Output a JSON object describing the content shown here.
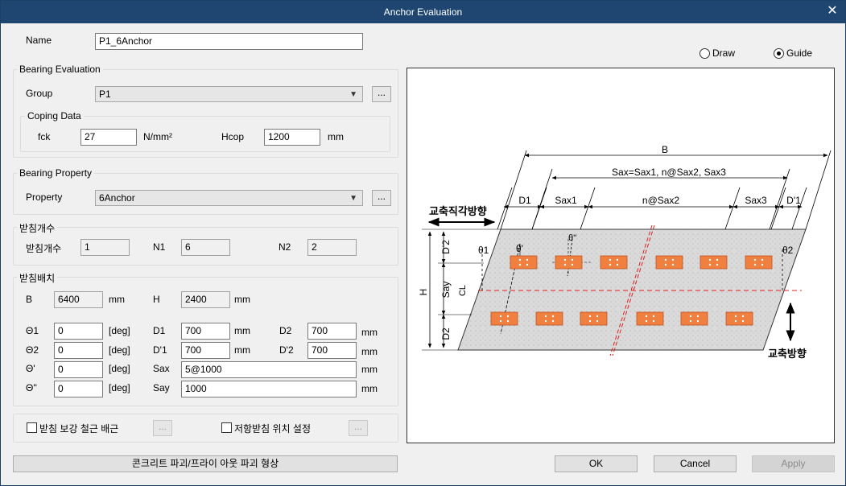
{
  "window": {
    "title": "Anchor Evaluation",
    "close_icon": "close-icon"
  },
  "name": {
    "label": "Name",
    "value": "P1_6Anchor"
  },
  "view_mode": {
    "draw_label": "Draw",
    "guide_label": "Guide",
    "selected": "Guide"
  },
  "bearing_evaluation": {
    "title": "Bearing Evaluation",
    "group_label": "Group",
    "group_value": "P1",
    "more_label": "...",
    "coping": {
      "title": "Coping Data",
      "fck_label": "fck",
      "fck_value": "27",
      "fck_unit": "N/mm²",
      "hcop_label": "Hcop",
      "hcop_value": "1200",
      "hcop_unit": "mm"
    }
  },
  "bearing_property": {
    "title": "Bearing Property",
    "property_label": "Property",
    "property_value": "6Anchor",
    "more_label": "..."
  },
  "count": {
    "title": "받침개수",
    "count_label": "받침개수",
    "count_value": "1",
    "n1_label": "N1",
    "n1_value": "6",
    "n2_label": "N2",
    "n2_value": "2"
  },
  "layout": {
    "title": "받침배치",
    "b_label": "B",
    "b_value": "6400",
    "b_unit": "mm",
    "h_label": "H",
    "h_value": "2400",
    "h_unit": "mm",
    "theta1_label": "Θ1",
    "theta1_value": "0",
    "theta1_unit": "[deg]",
    "d1_label": "D1",
    "d1_value": "700",
    "d1_unit": "mm",
    "d2_label": "D2",
    "d2_value": "700",
    "d2_unit": "mm",
    "theta2_label": "Θ2",
    "theta2_value": "0",
    "theta2_unit": "[deg]",
    "dp1_label": "D'1",
    "dp1_value": "700",
    "dp1_unit": "mm",
    "dp2_label": "D'2",
    "dp2_value": "700",
    "dp2_unit": "mm",
    "thetap_label": "Θ'",
    "thetap_value": "0",
    "thetap_unit": "[deg]",
    "sax_label": "Sax",
    "sax_value": "5@1000",
    "sax_unit": "mm",
    "thetapp_label": "Θ''",
    "thetapp_value": "0",
    "thetapp_unit": "[deg]",
    "say_label": "Say",
    "say_value": "1000",
    "say_unit": "mm"
  },
  "options": {
    "rebar_label": "받침 보강 철근 배근",
    "rebar_more": "...",
    "position_label": "저항받침 위치 설정",
    "position_more": "..."
  },
  "buttons": {
    "concrete": "콘크리트 파괴/프라이 아웃 파괴 형상",
    "ok": "OK",
    "cancel": "Cancel",
    "apply": "Apply"
  },
  "diagram": {
    "b": "B",
    "sax_formula": "Sax=Sax1, n@Sax2, Sax3",
    "d1": "D1",
    "sax1": "Sax1",
    "nsax2": "n@Sax2",
    "sax3": "Sax3",
    "dp1": "D'1",
    "transverse": "교축직각방향",
    "longitudinal": "교축방향",
    "h": "H",
    "dp2": "D'2",
    "say": "Say",
    "d2": "D2",
    "cl": "CL",
    "theta1": "θ1",
    "theta2": "θ2",
    "thetap": "θ'",
    "thetapp": "θ''",
    "colors": {
      "bearing": "#f08040",
      "cut_line": "#e02020",
      "deck": "#d8d8d8"
    }
  }
}
